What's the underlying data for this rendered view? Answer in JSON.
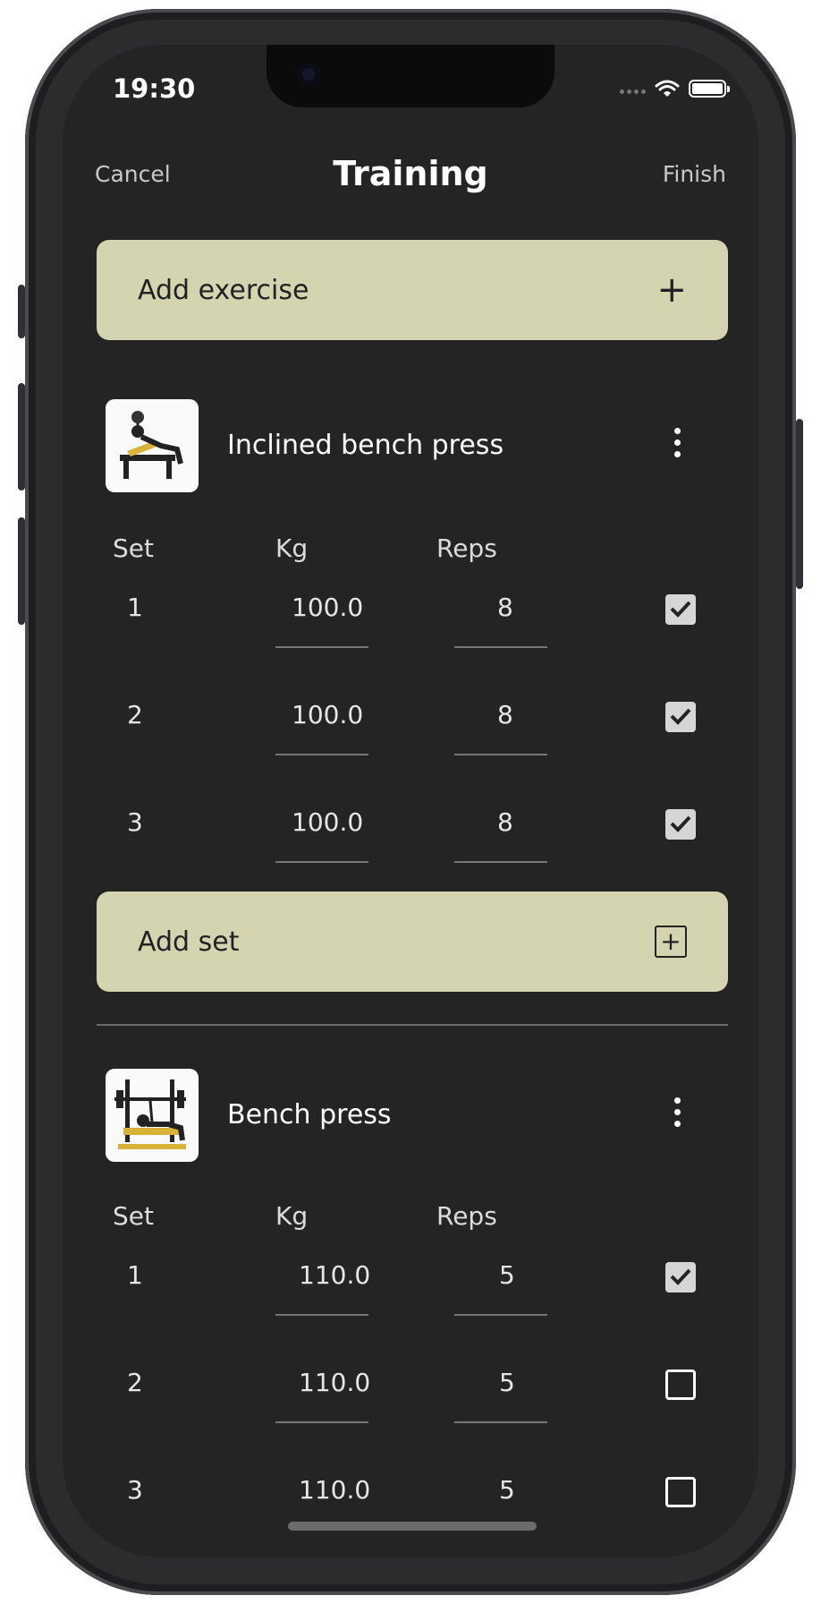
{
  "status_bar": {
    "time": "19:30"
  },
  "nav": {
    "cancel": "Cancel",
    "title": "Training",
    "finish": "Finish"
  },
  "add_exercise": {
    "label": "Add exercise"
  },
  "table_headers": {
    "set": "Set",
    "kg": "Kg",
    "reps": "Reps"
  },
  "exercises": [
    {
      "name": "Inclined bench press",
      "sets": [
        {
          "set": "1",
          "kg": "100.0",
          "reps": "8",
          "done": true
        },
        {
          "set": "2",
          "kg": "100.0",
          "reps": "8",
          "done": true
        },
        {
          "set": "3",
          "kg": "100.0",
          "reps": "8",
          "done": true
        }
      ],
      "add_set_label": "Add set"
    },
    {
      "name": "Bench press",
      "sets": [
        {
          "set": "1",
          "kg": "110.0",
          "reps": "5",
          "done": true
        },
        {
          "set": "2",
          "kg": "110.0",
          "reps": "5",
          "done": false
        },
        {
          "set": "3",
          "kg": "110.0",
          "reps": "5",
          "done": false
        }
      ]
    }
  ],
  "colors": {
    "background": "#242424",
    "accent_button": "#d5d4b1",
    "text": "#ffffff"
  }
}
